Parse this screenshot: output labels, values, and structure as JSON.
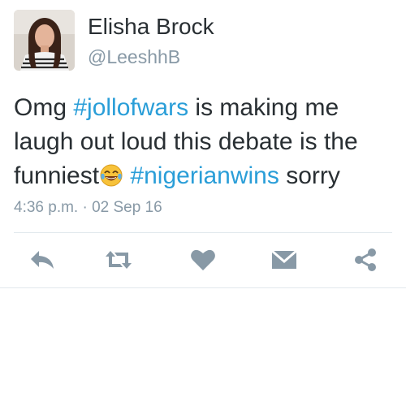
{
  "author": {
    "name": "Elisha Brock",
    "handle": "@LeeshhB"
  },
  "tweet": {
    "segments": [
      {
        "text": "Omg ",
        "type": "text"
      },
      {
        "text": "#jollofwars",
        "type": "hashtag"
      },
      {
        "text": " is making me laugh out loud this debate is the funniest",
        "type": "text"
      },
      {
        "text": "",
        "type": "emoji",
        "icon": "tears-of-joy-emoji"
      },
      {
        "text": " ",
        "type": "text"
      },
      {
        "text": "#nigerianwins",
        "type": "hashtag"
      },
      {
        "text": " sorry",
        "type": "text"
      }
    ],
    "timestamp": "4:36 p.m. · 02 Sep 16"
  },
  "actions": [
    {
      "name": "reply",
      "icon": "reply-icon"
    },
    {
      "name": "retweet",
      "icon": "retweet-icon"
    },
    {
      "name": "like",
      "icon": "heart-icon"
    },
    {
      "name": "message",
      "icon": "envelope-icon"
    },
    {
      "name": "share",
      "icon": "share-icon"
    }
  ],
  "colors": {
    "hashtag": "#2a9ed8",
    "text": "#292f33",
    "muted": "#8899a6",
    "action_icon": "#8899a6",
    "divider": "#e1e8ed"
  }
}
